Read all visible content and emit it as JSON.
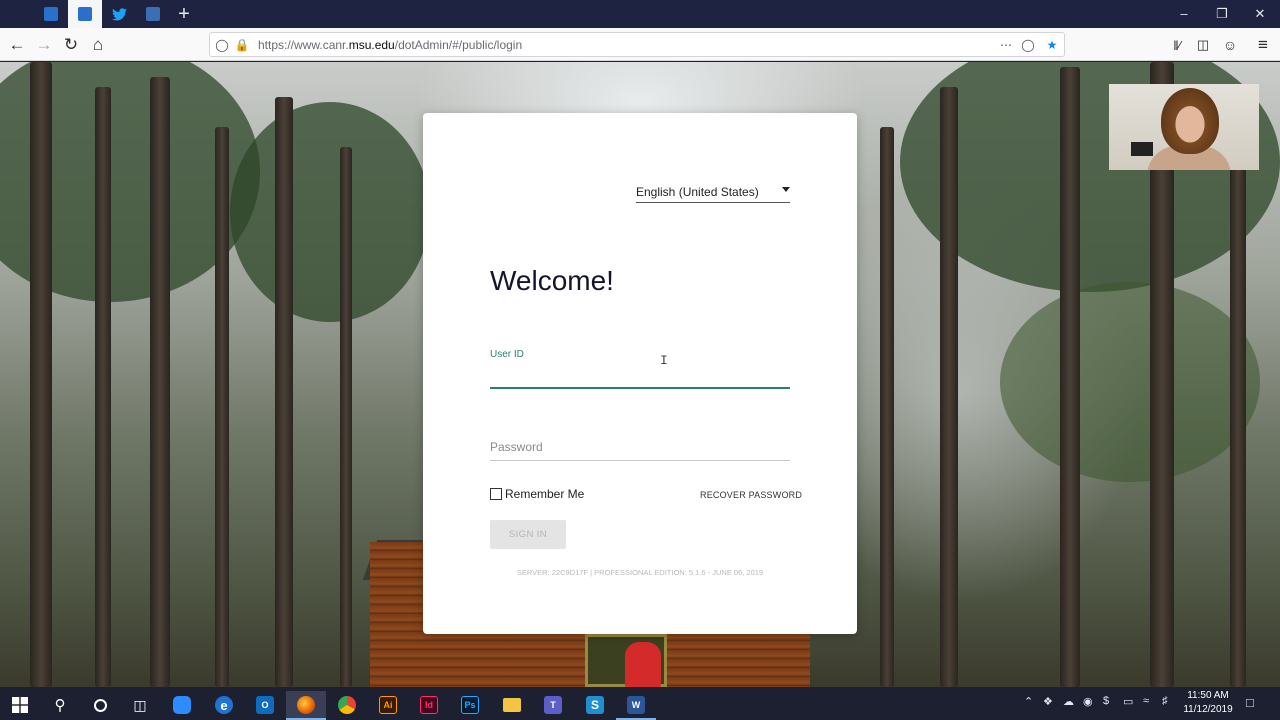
{
  "browser": {
    "tabs": [
      {
        "name": "tab-1",
        "color": "#2a6fc9"
      },
      {
        "name": "tab-2-active",
        "color": "#2a6fc9"
      },
      {
        "name": "tab-twitter",
        "color": "#1da1f2"
      },
      {
        "name": "tab-4",
        "color": "#3b6fb5"
      }
    ],
    "new_tab_icon": "+",
    "url": {
      "prefix": "https://www.canr.",
      "domain": "msu.edu",
      "path": "/dotAdmin/#/public/login"
    }
  },
  "login": {
    "language": "English (United States)",
    "title": "Welcome!",
    "user_id_label": "User ID",
    "user_id_value": "",
    "password_placeholder": "Password",
    "remember_me": "Remember Me",
    "remember_checked": false,
    "recover_password": "RECOVER PASSWORD",
    "sign_in": "SIGN IN",
    "server_info": "SERVER: 22C9D17F | PROFESSIONAL EDITION: 5.1.6 - JUNE 06, 2019"
  },
  "taskbar": {
    "apps": [
      {
        "name": "zoom",
        "label": "",
        "color": "#2d8cff"
      },
      {
        "name": "edge",
        "label": "e",
        "color": "#1f74cf"
      },
      {
        "name": "outlook",
        "label": "O",
        "color": "#0f6cbd"
      },
      {
        "name": "firefox",
        "label": "",
        "color": "#e66000"
      },
      {
        "name": "chrome",
        "label": "",
        "color": "#34a853"
      },
      {
        "name": "illustrator",
        "label": "Ai",
        "color": "#3a1a00"
      },
      {
        "name": "indesign",
        "label": "Id",
        "color": "#49021f"
      },
      {
        "name": "photoshop",
        "label": "Ps",
        "color": "#001e36"
      },
      {
        "name": "file-explorer",
        "label": "",
        "color": "#f4c542"
      },
      {
        "name": "teams",
        "label": "T",
        "color": "#5b5fc7"
      },
      {
        "name": "snagit",
        "label": "S",
        "color": "#1f8fd0"
      },
      {
        "name": "word",
        "label": "W",
        "color": "#2b579a"
      }
    ],
    "time": "11:50 AM",
    "date": "11/12/2019"
  }
}
